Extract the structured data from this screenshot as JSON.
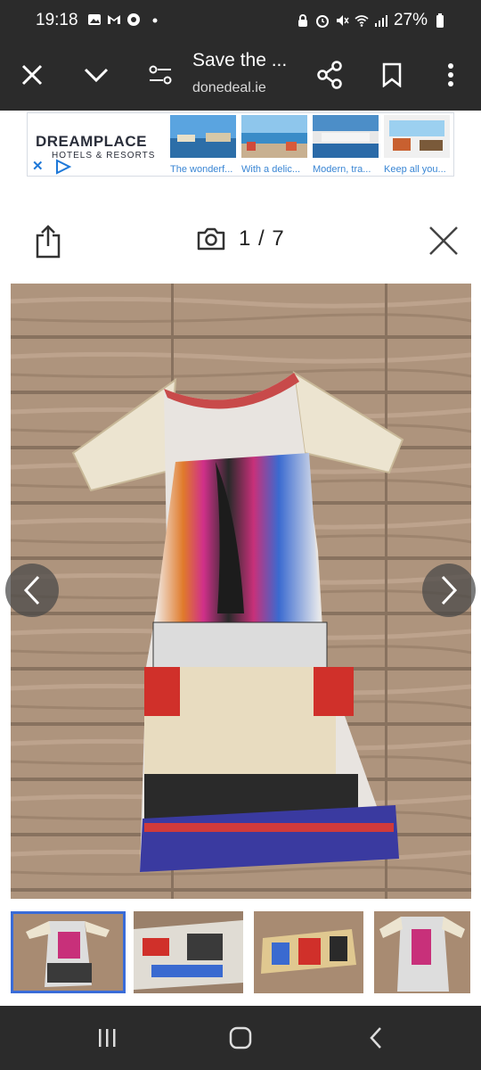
{
  "status": {
    "time": "19:18",
    "battery": "27%",
    "left_icons": [
      "gallery-icon",
      "gmail-icon",
      "chrome-icon",
      "dot-icon"
    ],
    "right_icons": [
      "lock-icon",
      "alarm-icon",
      "mute-icon",
      "wifi-icon",
      "signal-icon",
      "battery-icon"
    ]
  },
  "toolbar": {
    "title": "Save the ...",
    "url": "donedeal.ie"
  },
  "ad": {
    "brand": "DREAMPLACE",
    "subtitle": "HOTELS & RESORTS",
    "items": [
      {
        "caption": "The wonderf..."
      },
      {
        "caption": "With a delic..."
      },
      {
        "caption": "Modern, tra..."
      },
      {
        "caption": "Keep all you..."
      }
    ]
  },
  "gallery": {
    "counter": "1 / 7"
  },
  "colors": {
    "bar_bg": "#2b2b2b",
    "ad_link": "#3a86d4",
    "selected_thumb": "#3a6cd8"
  }
}
